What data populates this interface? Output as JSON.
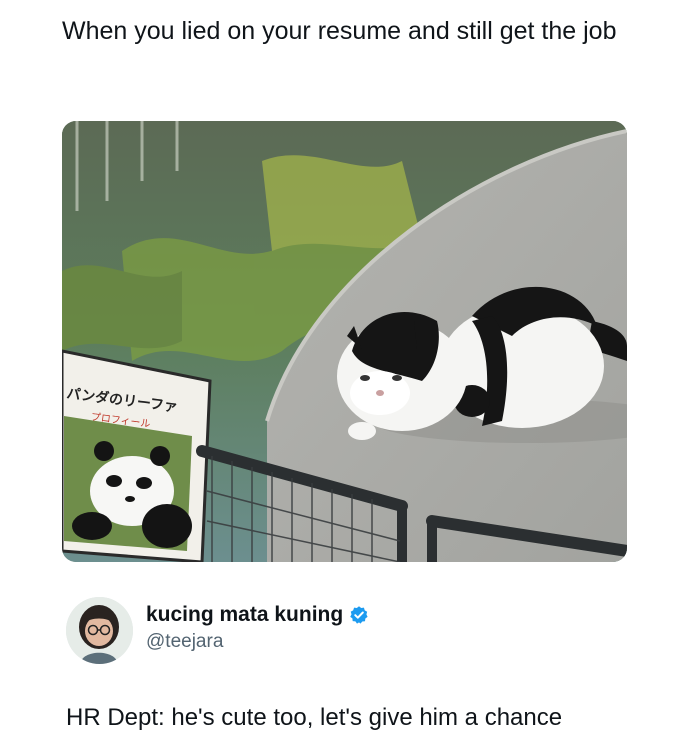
{
  "caption": "When you lied on your resume and still get the job",
  "photo": {
    "sign_title": "パンダのリーファ",
    "sign_subtitle": "プロフィール"
  },
  "tweet": {
    "display_name": "kucing mata kuning",
    "handle": "@teejara",
    "verified_color": "#1d9bf0",
    "text": "HR Dept: he's cute too, let's give him a chance"
  }
}
